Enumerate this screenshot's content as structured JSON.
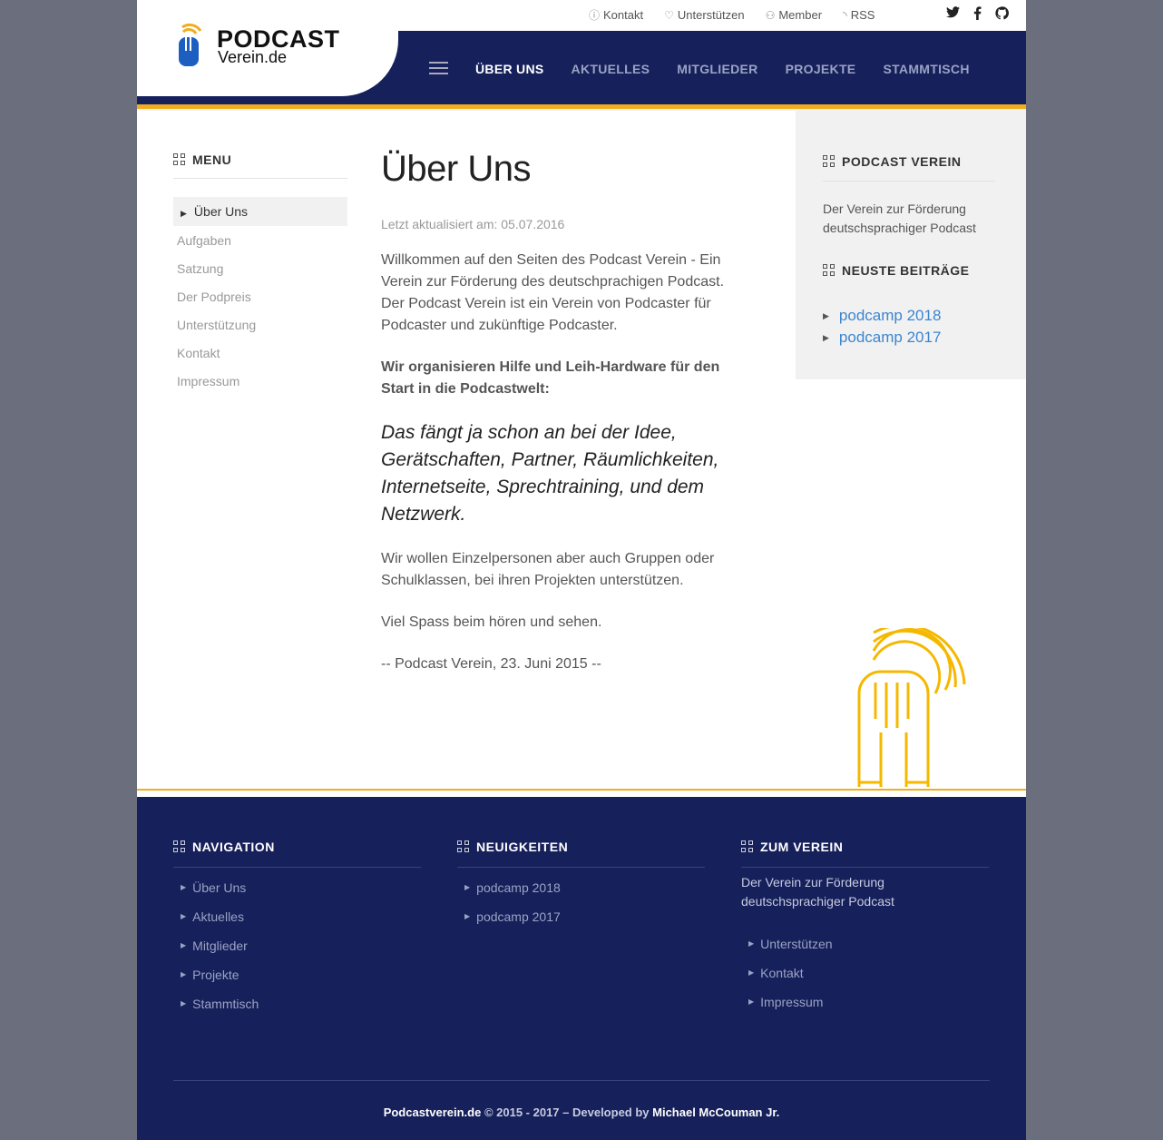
{
  "topbar": {
    "links": [
      {
        "icon": "help-circle-icon",
        "label": "Kontakt"
      },
      {
        "icon": "heart-icon",
        "label": "Unterstützen"
      },
      {
        "icon": "users-icon",
        "label": "Member"
      },
      {
        "icon": "rss-icon",
        "label": "RSS"
      }
    ],
    "social": [
      "twitter-icon",
      "facebook-icon",
      "github-icon"
    ]
  },
  "logo": {
    "line1": "PODCAST",
    "line2": "Verein.de"
  },
  "nav": {
    "items": [
      "ÜBER UNS",
      "AKTUELLES",
      "MITGLIEDER",
      "PROJEKTE",
      "STAMMTISCH"
    ],
    "active_index": 0
  },
  "sidebar": {
    "title": "MENU",
    "items": [
      "Über Uns",
      "Aufgaben",
      "Satzung",
      "Der Podpreis",
      "Unterstützung",
      "Kontakt",
      "Impressum"
    ]
  },
  "main": {
    "title": "Über Uns",
    "updated": "Letzt aktualisiert am: 05.07.2016",
    "intro": "Willkommen auf den Seiten des Podcast Verein - Ein Verein zur Förderung des deutschprachigen Podcast. Der Podcast Verein ist ein Verein von Podcaster für Podcaster und zukünftige Podcaster.",
    "bold": "Wir organisieren Hilfe und Leih-Hardware für den Start in die Podcastwelt:",
    "quote": "Das fängt ja schon an bei der Idee, Gerätschaften, Partner, Räumlichkeiten, Internetseite, Sprechtraining, und dem Netzwerk.",
    "p2": "Wir wollen Einzelpersonen aber auch Gruppen oder Schulklassen, bei ihren Projekten unterstützen.",
    "p3": "Viel Spass beim hören und sehen.",
    "signature": "-- Podcast Verein, 23. Juni 2015 --"
  },
  "right": {
    "title1": "PODCAST VEREIN",
    "text1": "Der Verein zur Förderung deutschsprachiger Podcast",
    "title2": "NEUSTE BEITRÄGE",
    "posts": [
      "podcamp 2018",
      "podcamp 2017"
    ]
  },
  "footer": {
    "nav_title": "NAVIGATION",
    "nav_items": [
      "Über Uns",
      "Aktuelles",
      "Mitglieder",
      "Projekte",
      "Stammtisch"
    ],
    "news_title": "NEUIGKEITEN",
    "news_items": [
      "podcamp 2018",
      "podcamp 2017"
    ],
    "club_title": "ZUM VEREIN",
    "club_text": "Der Verein zur Förderung deutschsprachiger Podcast",
    "club_items": [
      "Unterstützen",
      "Kontakt",
      "Impressum"
    ],
    "copyright_site": "Podcastverein.de",
    "copyright_mid": " © 2015 - 2017 – Developed by ",
    "copyright_author": "Michael McCouman Jr."
  },
  "colors": {
    "navy": "#16205a",
    "accent": "#f0ad1e",
    "link": "#3b86d1",
    "logo_blue": "#1d5fc1"
  }
}
